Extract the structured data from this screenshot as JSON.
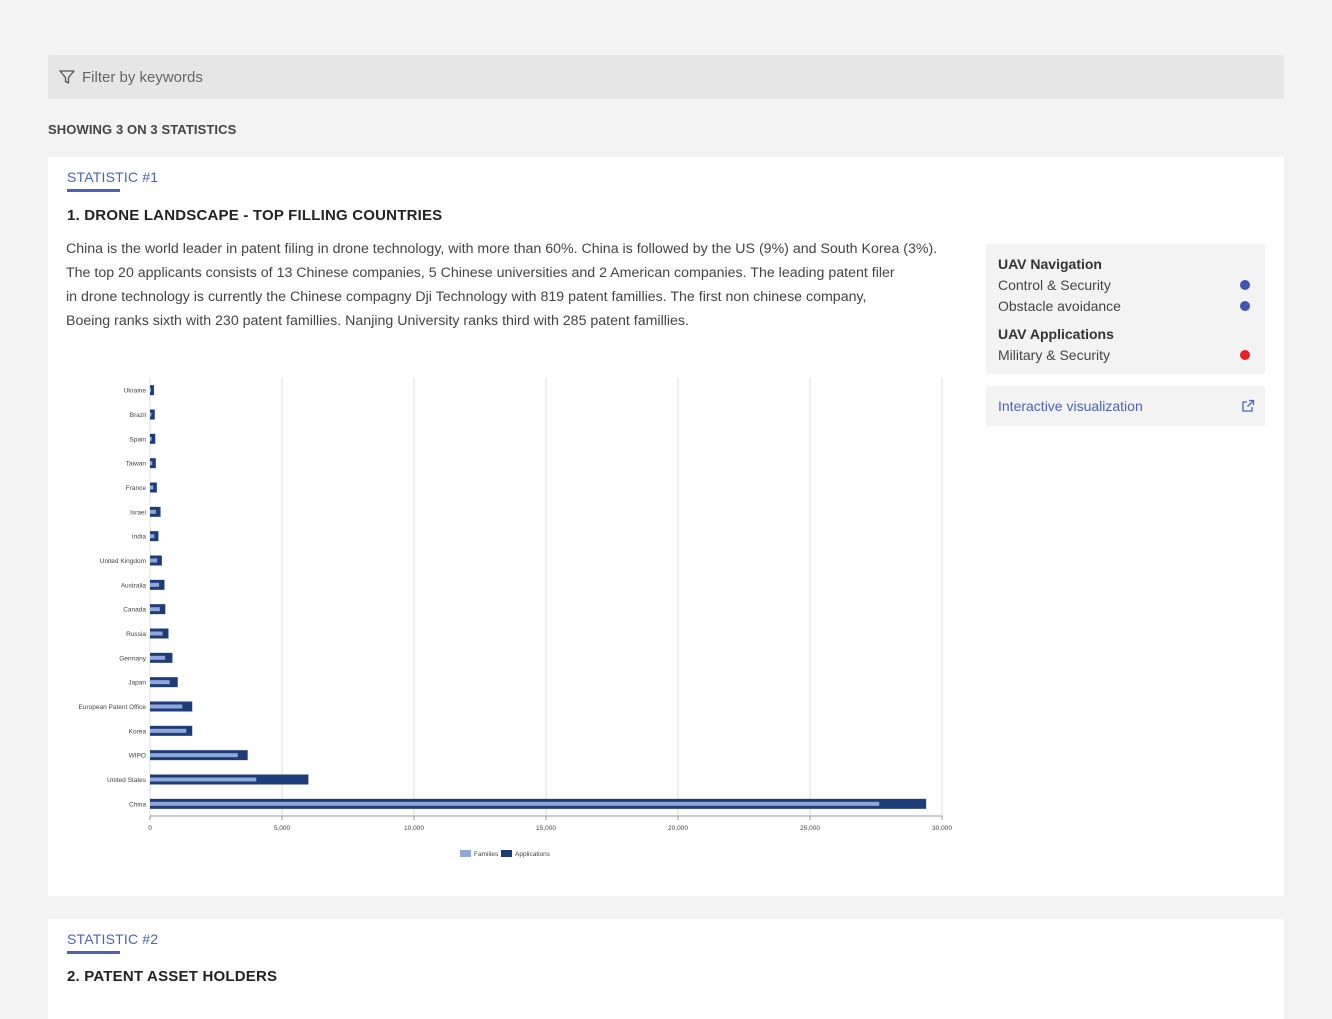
{
  "filter": {
    "placeholder": "Filter by keywords"
  },
  "showing_text": "SHOWING 3 ON 3 STATISTICS",
  "statistics": [
    {
      "label": "STATISTIC",
      "number": "#1",
      "title": "1. DRONE LANDSCAPE - TOP FILLING COUNTRIES",
      "description_lines": [
        "China is the world leader in patent filing in drone technology, with more than 60%. China is followed by the US (9%) and South Korea (3%).",
        "The top 20 applicants consists of 13 Chinese companies, 5 Chinese universities and 2 American companies. The leading patent filer",
        "in drone technology is currently the Chinese compagny Dji Technology with 819 patent famillies. The first non chinese company,",
        "Boeing ranks sixth with 230 patent famillies. Nanjing University ranks third with 285 patent famillies."
      ],
      "tags": {
        "groups": [
          {
            "title": "UAV Navigation",
            "items": [
              {
                "label": "Control & Security",
                "color": "#3f56b0"
              },
              {
                "label": "Obstacle avoidance",
                "color": "#3f56b0"
              }
            ]
          },
          {
            "title": "UAV Applications",
            "items": [
              {
                "label": "Military & Security",
                "color": "#e8202a"
              }
            ]
          }
        ]
      },
      "interactive_label": "Interactive visualization",
      "interactive_icon": "external-link-icon"
    },
    {
      "label": "STATISTIC",
      "number": "#2",
      "title": "2. PATENT ASSET HOLDERS"
    }
  ],
  "colors": {
    "accent": "#4a63b8",
    "families": "#8fa8d8",
    "applications": "#1e3c78"
  },
  "chart_data": {
    "type": "bar",
    "orientation": "horizontal",
    "categories": [
      "Ukraine",
      "Brazil",
      "Spain",
      "Taiwan",
      "France",
      "Israel",
      "India",
      "United Kingdom",
      "Australia",
      "Canada",
      "Russia",
      "Germany",
      "Japan",
      "European Patent Office",
      "Korea",
      "WIPO",
      "United States",
      "China"
    ],
    "series": [
      {
        "name": "Families",
        "color": "#8fa8d8",
        "values": [
          100,
          130,
          140,
          160,
          200,
          300,
          240,
          350,
          420,
          450,
          550,
          650,
          820,
          1300,
          1450,
          3400,
          4100,
          27700
        ]
      },
      {
        "name": "Applications",
        "color": "#1e3c78",
        "values": [
          150,
          180,
          200,
          220,
          260,
          400,
          320,
          450,
          550,
          580,
          700,
          850,
          1050,
          1600,
          1600,
          3700,
          6000,
          29400
        ]
      }
    ],
    "xticks": [
      "0",
      "5,000",
      "10,000",
      "15,000",
      "20,000",
      "25,000",
      "30,000"
    ],
    "xlim": [
      0,
      30000
    ],
    "grid": true,
    "legend_position": "bottom-center"
  }
}
